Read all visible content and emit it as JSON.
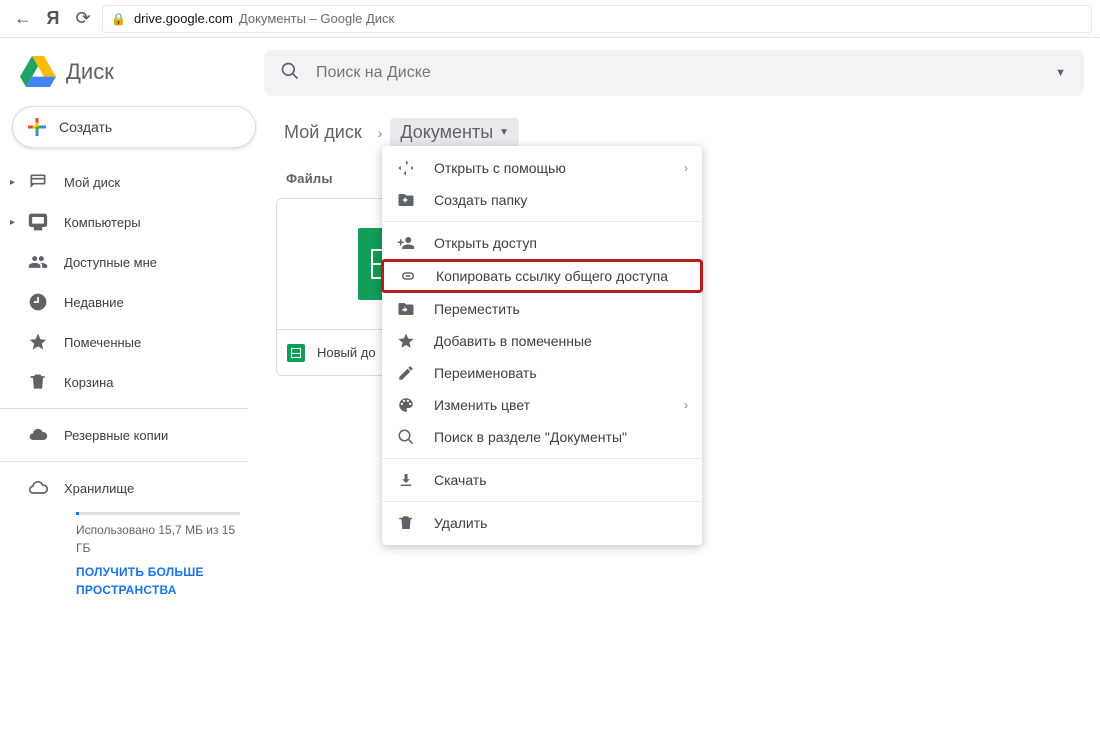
{
  "browser": {
    "url_host": "drive.google.com",
    "url_rest": "Документы – Google Диск"
  },
  "app_name": "Диск",
  "new_button_label": "Создать",
  "search": {
    "placeholder": "Поиск на Диске"
  },
  "sidebar": {
    "items": [
      {
        "label": "Мой диск"
      },
      {
        "label": "Компьютеры"
      },
      {
        "label": "Доступные мне"
      },
      {
        "label": "Недавние"
      },
      {
        "label": "Помеченные"
      },
      {
        "label": "Корзина"
      },
      {
        "label": "Резервные копии"
      },
      {
        "label": "Хранилище"
      }
    ]
  },
  "storage": {
    "text": "Использовано 15,7 МБ из 15 ГБ",
    "link": "ПОЛУЧИТЬ БОЛЬШЕ ПРОСТРАНСТВА"
  },
  "breadcrumb": {
    "root": "Мой диск",
    "current": "Документы"
  },
  "section": "Файлы",
  "file": {
    "name": "Новый до"
  },
  "ctx": {
    "open_with": "Открыть с помощью",
    "new_folder": "Создать папку",
    "share": "Открыть доступ",
    "copy_link": "Копировать ссылку общего доступа",
    "move": "Переместить",
    "star": "Добавить в помеченные",
    "rename": "Переименовать",
    "color": "Изменить цвет",
    "search_in": "Поиск в разделе \"Документы\"",
    "download": "Скачать",
    "delete": "Удалить"
  }
}
